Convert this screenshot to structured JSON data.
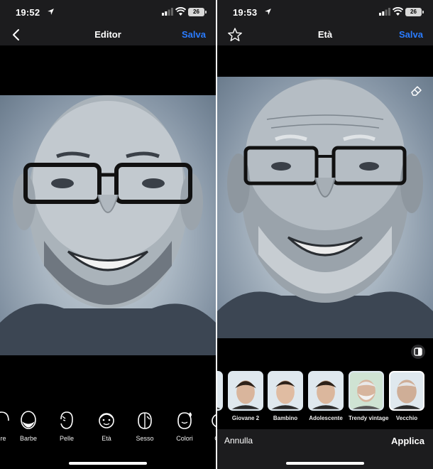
{
  "left_screen": {
    "status": {
      "time": "19:52",
      "battery": "26"
    },
    "nav": {
      "title": "Editor",
      "save": "Salva"
    },
    "tools": [
      {
        "label": "ure",
        "icon": "hair-icon"
      },
      {
        "label": "Barbe",
        "icon": "beard-icon"
      },
      {
        "label": "Pelle",
        "icon": "skin-icon"
      },
      {
        "label": "Età",
        "icon": "age-icon"
      },
      {
        "label": "Sesso",
        "icon": "gender-icon"
      },
      {
        "label": "Colori",
        "icon": "colors-icon"
      },
      {
        "label": "Oc",
        "icon": "eyes-icon"
      }
    ]
  },
  "right_screen": {
    "status": {
      "time": "19:53",
      "battery": "26"
    },
    "nav": {
      "title": "Età",
      "save": "Salva"
    },
    "filters": [
      {
        "label": "",
        "selected": false
      },
      {
        "label": "Giovane 2",
        "selected": false
      },
      {
        "label": "Bambino",
        "selected": false
      },
      {
        "label": "Adolescente",
        "selected": false
      },
      {
        "label": "Trendy vintage",
        "selected": false
      },
      {
        "label": "Vecchio",
        "selected": true
      }
    ],
    "actions": {
      "cancel": "Annulla",
      "apply": "Applica"
    }
  },
  "colors": {
    "accent": "#2a7cff",
    "bar_bg": "#1c1c1e",
    "background": "#000000"
  }
}
